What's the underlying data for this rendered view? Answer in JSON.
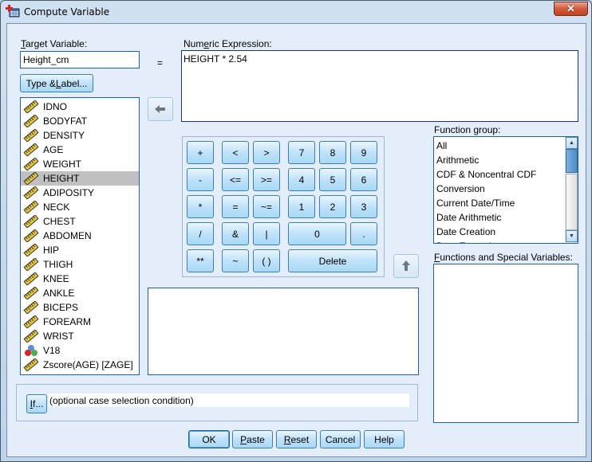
{
  "window": {
    "title": "Compute Variable",
    "close_label": "✕"
  },
  "target": {
    "label_prefix": "",
    "label_u": "T",
    "label_rest": "arget Variable:",
    "value": "Height_cm"
  },
  "equals": "=",
  "type_label_button": {
    "pre": "Type & ",
    "u": "L",
    "post": "abel..."
  },
  "expression": {
    "label_pre": "Num",
    "label_u": "e",
    "label_post": "ric Expression:",
    "value": "HEIGHT * 2.54"
  },
  "variables": [
    {
      "name": "IDNO",
      "type": "scale",
      "selected": false
    },
    {
      "name": "BODYFAT",
      "type": "scale",
      "selected": false
    },
    {
      "name": "DENSITY",
      "type": "scale",
      "selected": false
    },
    {
      "name": "AGE",
      "type": "scale",
      "selected": false
    },
    {
      "name": "WEIGHT",
      "type": "scale",
      "selected": false
    },
    {
      "name": "HEIGHT",
      "type": "scale",
      "selected": true
    },
    {
      "name": "ADIPOSITY",
      "type": "scale",
      "selected": false
    },
    {
      "name": "NECK",
      "type": "scale",
      "selected": false
    },
    {
      "name": "CHEST",
      "type": "scale",
      "selected": false
    },
    {
      "name": "ABDOMEN",
      "type": "scale",
      "selected": false
    },
    {
      "name": "HIP",
      "type": "scale",
      "selected": false
    },
    {
      "name": "THIGH",
      "type": "scale",
      "selected": false
    },
    {
      "name": "KNEE",
      "type": "scale",
      "selected": false
    },
    {
      "name": "ANKLE",
      "type": "scale",
      "selected": false
    },
    {
      "name": "BICEPS",
      "type": "scale",
      "selected": false
    },
    {
      "name": "FOREARM",
      "type": "scale",
      "selected": false
    },
    {
      "name": "WRIST",
      "type": "scale",
      "selected": false
    },
    {
      "name": "V18",
      "type": "nominal",
      "selected": false
    },
    {
      "name": "Zscore(AGE) [ZAGE]",
      "type": "scale",
      "selected": false
    }
  ],
  "keypad": {
    "operators": [
      [
        "+",
        "<",
        ">"
      ],
      [
        "-",
        "<=",
        ">="
      ],
      [
        "*",
        "=",
        "~="
      ],
      [
        "/",
        "&",
        "|"
      ],
      [
        "**",
        "~",
        "( )"
      ]
    ],
    "digits": [
      [
        "7",
        "8",
        "9"
      ],
      [
        "4",
        "5",
        "6"
      ],
      [
        "1",
        "2",
        "3"
      ]
    ],
    "zero": "0",
    "dot": ".",
    "delete": "Delete"
  },
  "function_group": {
    "label_pre": "Function ",
    "label_u": "g",
    "label_post": "roup:",
    "items": [
      "All",
      "Arithmetic",
      "CDF & Noncentral CDF",
      "Conversion",
      "Current Date/Time",
      "Date Arithmetic",
      "Date Creation",
      "Date Extraction"
    ]
  },
  "functions_special": {
    "label_u": "F",
    "label_post": "unctions and Special Variables:"
  },
  "if_button": {
    "u": "I",
    "post": "f..."
  },
  "if_condition": "(optional case selection condition)",
  "buttons": {
    "ok": "OK",
    "paste_u": "P",
    "paste_post": "aste",
    "reset_u": "R",
    "reset_post": "eset",
    "cancel": "Cancel",
    "help": "Help"
  },
  "icons": {
    "move_to_expression": "arrow-left-icon",
    "move_function_up": "arrow-up-icon",
    "scale_variable": "ruler-icon",
    "nominal_variable": "nominal-balls-icon"
  }
}
